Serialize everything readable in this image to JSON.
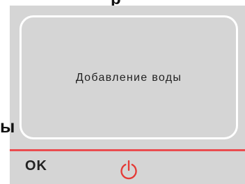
{
  "header": {
    "partial_text": "р"
  },
  "message": {
    "text": "Добавление воды"
  },
  "left_edge": {
    "partial_text": "ы"
  },
  "footer": {
    "ok_label": "OK",
    "power_icon": "power-icon"
  },
  "colors": {
    "panel_background": "#d5d5d5",
    "card_border": "#ffffff",
    "accent_line": "#ea4c4f",
    "power_icon": "#e53935",
    "text": "#222222"
  }
}
